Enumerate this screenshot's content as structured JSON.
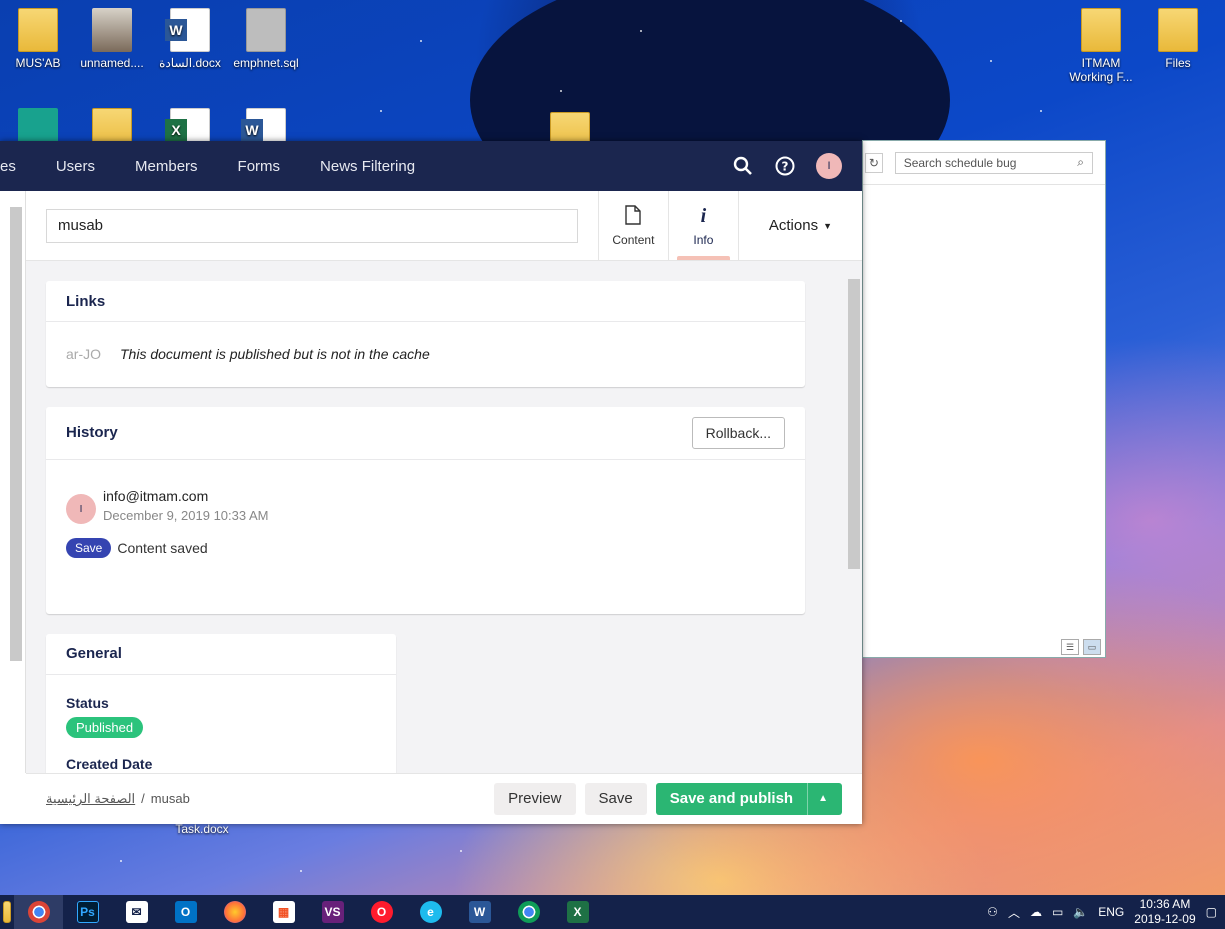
{
  "desktop": {
    "icons": [
      {
        "label": "MUS'AB",
        "kind": "folder"
      },
      {
        "label": "unnamed....",
        "kind": "photo"
      },
      {
        "label": "السادة.docx",
        "kind": "word"
      },
      {
        "label": "emphnet.sql",
        "kind": "sql"
      },
      {
        "label": "ITMAM Working F...",
        "kind": "folder"
      },
      {
        "label": "Files",
        "kind": "folder"
      },
      {
        "label": "Task.docx",
        "kind": "word"
      }
    ]
  },
  "explorer": {
    "search_placeholder": "Search schedule bug"
  },
  "app": {
    "nav": [
      "es",
      "Users",
      "Members",
      "Forms",
      "News Filtering"
    ],
    "avatar_initial": "I",
    "node_name": "musab",
    "tabs": [
      {
        "label": "Content",
        "icon": "document-icon"
      },
      {
        "label": "Info",
        "icon": "info-icon",
        "active": true
      }
    ],
    "actions_label": "Actions",
    "links": {
      "title": "Links",
      "lang": "ar-JO",
      "message": "This document is published but is not in the cache"
    },
    "history": {
      "title": "History",
      "rollback_label": "Rollback...",
      "entry_initial": "I",
      "user": "info@itmam.com",
      "date": "December 9, 2019 10:33 AM",
      "badge": "Save",
      "action_text": "Content saved"
    },
    "general": {
      "title": "General",
      "status_label": "Status",
      "status_value": "Published",
      "created_label": "Created Date"
    },
    "breadcrumb": {
      "home": "الصفحة الرئيسية",
      "separator": "/",
      "current": "musab"
    },
    "buttons": {
      "preview": "Preview",
      "save": "Save",
      "save_publish": "Save and publish"
    }
  },
  "taskbar": {
    "apps": [
      "File Explorer",
      "Chrome",
      "Photoshop",
      "Mail",
      "Outlook",
      "Firefox",
      "Store",
      "Visual Studio",
      "Opera",
      "Internet Explorer",
      "Word",
      "Chrome",
      "Excel"
    ],
    "lang": "ENG",
    "time": "10:36 AM",
    "date": "2019-12-09"
  },
  "colors": {
    "nav_bg": "#1b264f",
    "publish_green": "#2bb673",
    "published_badge": "#2bc37c",
    "save_badge": "#3544b1",
    "active_tab_underline": "#f5c1b6"
  }
}
